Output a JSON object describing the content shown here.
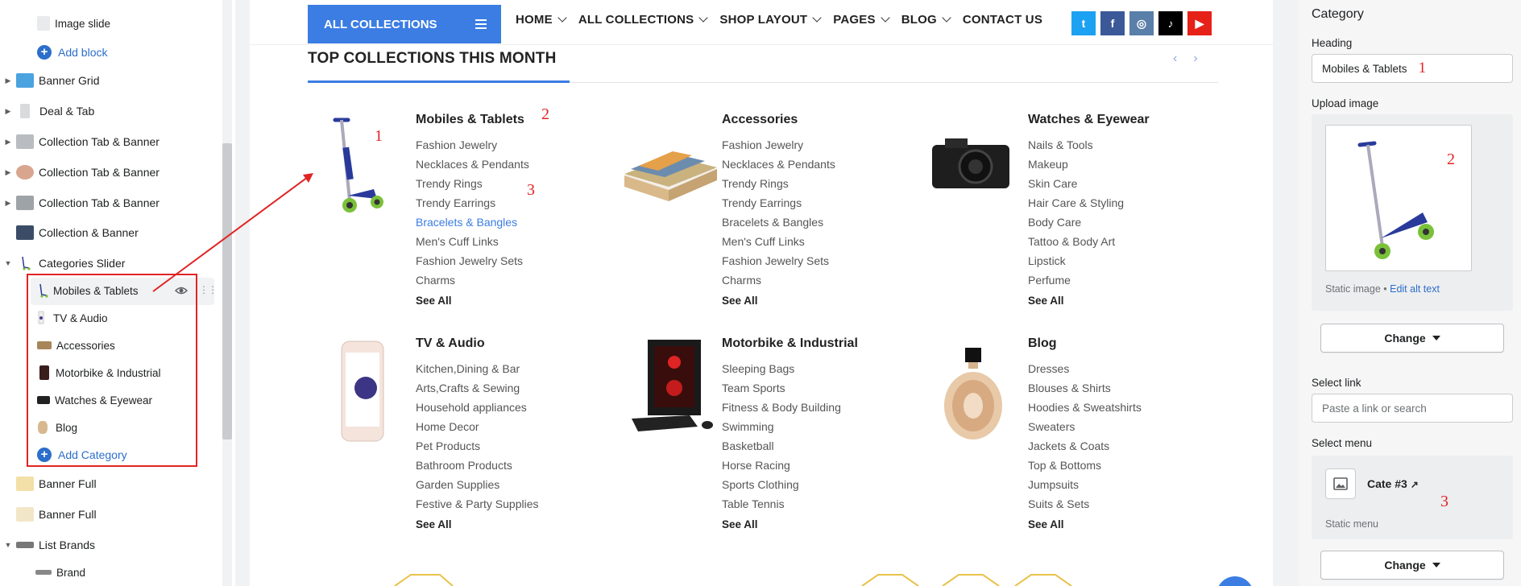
{
  "sidebar": {
    "items": [
      {
        "label": "Image slide",
        "child": true
      },
      {
        "label": "Add block",
        "add": true
      },
      {
        "label": "Banner Grid"
      },
      {
        "label": "Deal & Tab"
      },
      {
        "label": "Collection Tab & Banner"
      },
      {
        "label": "Collection Tab & Banner"
      },
      {
        "label": "Collection Tab & Banner"
      },
      {
        "label": "Collection & Banner"
      },
      {
        "label": "Categories Slider"
      }
    ],
    "categories_children": [
      {
        "label": "Mobiles & Tablets"
      },
      {
        "label": "TV & Audio"
      },
      {
        "label": "Accessories"
      },
      {
        "label": "Motorbike & Industrial"
      },
      {
        "label": "Watches & Eyewear"
      },
      {
        "label": "Blog"
      }
    ],
    "add_category": "Add Category",
    "after": [
      {
        "label": "Banner Full"
      },
      {
        "label": "Banner Full"
      },
      {
        "label": "List Brands"
      },
      {
        "label": "Brand"
      }
    ]
  },
  "nav": {
    "all_collections": "ALL COLLECTIONS",
    "menu": [
      {
        "label": "HOME",
        "chevron": true
      },
      {
        "label": "ALL COLLECTIONS",
        "chevron": true
      },
      {
        "label": "SHOP LAYOUT",
        "chevron": true
      },
      {
        "label": "PAGES",
        "chevron": true
      },
      {
        "label": "BLOG",
        "chevron": true
      },
      {
        "label": "CONTACT US",
        "chevron": false
      }
    ],
    "social": [
      {
        "icon": "twitter-icon",
        "glyph": "t",
        "color": "#1da1f2"
      },
      {
        "icon": "facebook-icon",
        "glyph": "f",
        "color": "#3b5998"
      },
      {
        "icon": "instagram-icon",
        "glyph": "◎",
        "color": "#5a7fa8"
      },
      {
        "icon": "tiktok-icon",
        "glyph": "♪",
        "color": "#000000"
      },
      {
        "icon": "youtube-icon",
        "glyph": "▶",
        "color": "#e62117"
      }
    ]
  },
  "section": {
    "title": "TOP COLLECTIONS THIS MONTH",
    "prev": "‹",
    "next": "›"
  },
  "categories": [
    {
      "title": "Mobiles & Tablets",
      "image": "scooter",
      "items": [
        "Fashion Jewelry",
        "Necklaces & Pendants",
        "Trendy Rings",
        "Trendy Earrings",
        "Bracelets & Bangles",
        "Men's Cuff Links",
        "Fashion Jewelry Sets",
        "Charms"
      ],
      "highlight": 4,
      "see_all": "See All"
    },
    {
      "title": "Accessories",
      "image": "bed",
      "items": [
        "Fashion Jewelry",
        "Necklaces & Pendants",
        "Trendy Rings",
        "Trendy Earrings",
        "Bracelets & Bangles",
        "Men's Cuff Links",
        "Fashion Jewelry Sets",
        "Charms"
      ],
      "highlight": -1,
      "see_all": "See All"
    },
    {
      "title": "Watches & Eyewear",
      "image": "camera",
      "items": [
        "Nails & Tools",
        "Makeup",
        "Skin Care",
        "Hair Care & Styling",
        "Body Care",
        "Tattoo & Body Art",
        "Lipstick",
        "Perfume"
      ],
      "highlight": -1,
      "see_all": "See All"
    },
    {
      "title": "TV & Audio",
      "image": "phone",
      "items": [
        "Kitchen,Dining & Bar",
        "Arts,Crafts & Sewing",
        "Household appliances",
        "Home Decor",
        "Pet Products",
        "Bathroom Products",
        "Garden Supplies",
        "Festive & Party Supplies"
      ],
      "highlight": -1,
      "see_all": "See All"
    },
    {
      "title": "Motorbike & Industrial",
      "image": "pc",
      "items": [
        "Sleeping Bags",
        "Team Sports",
        "Fitness & Body Building",
        "Swimming",
        "Basketball",
        "Horse Racing",
        "Sports Clothing",
        "Table Tennis"
      ],
      "highlight": -1,
      "see_all": "See All"
    },
    {
      "title": "Blog",
      "image": "perfume",
      "items": [
        "Dresses",
        "Blouses & Shirts",
        "Hoodies & Sweatshirts",
        "Sweaters",
        "Jackets & Coats",
        "Top & Bottoms",
        "Jumpsuits",
        "Suits & Sets"
      ],
      "highlight": -1,
      "see_all": "See All"
    }
  ],
  "annotations": {
    "one": "1",
    "two": "2",
    "three": "3"
  },
  "panel": {
    "title": "Category",
    "heading_label": "Heading",
    "heading_value": "Mobiles & Tablets",
    "upload_label": "Upload image",
    "static_image": "Static image",
    "edit_alt": "Edit alt text",
    "change": "Change",
    "select_link_label": "Select link",
    "select_link_placeholder": "Paste a link or search",
    "select_menu_label": "Select menu",
    "menu_name": "Cate #3",
    "static_menu": "Static menu",
    "change2": "Change"
  },
  "colors": {
    "accent": "#3b7de3",
    "annotation": "#e02424",
    "link": "#2c6ecb"
  }
}
